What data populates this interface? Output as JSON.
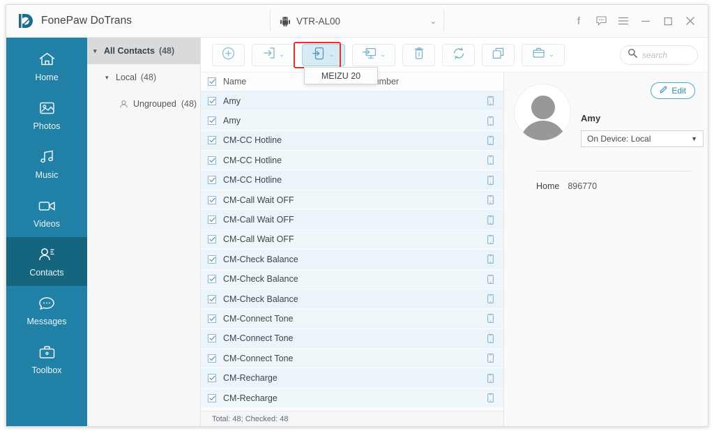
{
  "window": {
    "brand": "FonePaw DoTrans",
    "logo_icon": "dotrans-logo-icon",
    "device": {
      "icon": "android-robot-icon",
      "name": "VTR-AL00",
      "chevron": "⌄"
    },
    "controls": [
      {
        "name": "facebook-button",
        "glyph": "f"
      },
      {
        "name": "feedback-button",
        "glyph": "💬"
      },
      {
        "name": "menu-button",
        "glyph": "≡"
      },
      {
        "name": "minimize-button",
        "glyph": "–"
      },
      {
        "name": "maximize-button",
        "glyph": "□"
      },
      {
        "name": "close-button",
        "glyph": "✕"
      }
    ]
  },
  "sidebar": {
    "items": [
      {
        "label": "Home",
        "icon": "home-icon",
        "active": false
      },
      {
        "label": "Photos",
        "icon": "photos-icon",
        "active": false
      },
      {
        "label": "Music",
        "icon": "music-icon",
        "active": false
      },
      {
        "label": "Videos",
        "icon": "videos-icon",
        "active": false
      },
      {
        "label": "Contacts",
        "icon": "contacts-icon",
        "active": true
      },
      {
        "label": "Messages",
        "icon": "messages-icon",
        "active": false
      },
      {
        "label": "Toolbox",
        "icon": "toolbox-icon",
        "active": false
      }
    ],
    "active_bg": "#16657f",
    "bg": "#2180a5"
  },
  "tree": {
    "all_contacts": {
      "label": "All Contacts",
      "count": "(48)",
      "caret": "▾"
    },
    "local": {
      "label": "Local",
      "count": "(48)",
      "caret": "▾"
    },
    "ungrouped": {
      "label": "Ungrouped",
      "count": "(48)",
      "icon": "person-icon"
    }
  },
  "toolbar": {
    "buttons": [
      {
        "name": "add-contact-button",
        "icon": "plus-circle-icon",
        "chevron": false,
        "highlighted": false
      },
      {
        "name": "import-button",
        "icon": "import-arrow-icon",
        "chevron": true,
        "highlighted": false
      },
      {
        "name": "export-to-device-button",
        "icon": "export-phone-icon",
        "chevron": true,
        "highlighted": true
      },
      {
        "name": "export-to-computer-button",
        "icon": "export-monitor-icon",
        "chevron": true,
        "highlighted": false
      },
      {
        "name": "delete-button",
        "icon": "trash-icon",
        "chevron": false,
        "highlighted": false
      },
      {
        "name": "refresh-button",
        "icon": "refresh-icon",
        "chevron": false,
        "highlighted": false
      },
      {
        "name": "deduplicate-button",
        "icon": "copy-squares-icon",
        "chevron": false,
        "highlighted": false
      },
      {
        "name": "toolbox-button",
        "icon": "briefcase-icon",
        "chevron": true,
        "highlighted": false
      }
    ],
    "chevron_glyph": "⌄",
    "dropdown": {
      "option": "MEIZU 20"
    },
    "highlight_color": "#ef2b2b"
  },
  "search": {
    "placeholder": "search",
    "icon": "search-icon"
  },
  "list": {
    "columns": {
      "name": "Name",
      "phone": "Phone Number"
    },
    "header_checkbox_checked": true,
    "rows": [
      {
        "name": "Amy",
        "phone": "",
        "checked": true,
        "source_icon": "phone-icon"
      },
      {
        "name": "Amy",
        "phone": "",
        "checked": true,
        "source_icon": "phone-icon"
      },
      {
        "name": "CM-CC Hotline",
        "phone": "",
        "checked": true,
        "source_icon": "phone-icon"
      },
      {
        "name": "CM-CC Hotline",
        "phone": "",
        "checked": true,
        "source_icon": "phone-icon"
      },
      {
        "name": "CM-CC Hotline",
        "phone": "",
        "checked": true,
        "source_icon": "phone-icon"
      },
      {
        "name": "CM-Call Wait OFF",
        "phone": "",
        "checked": true,
        "source_icon": "phone-icon"
      },
      {
        "name": "CM-Call Wait OFF",
        "phone": "",
        "checked": true,
        "source_icon": "phone-icon"
      },
      {
        "name": "CM-Call Wait OFF",
        "phone": "",
        "checked": true,
        "source_icon": "phone-icon"
      },
      {
        "name": "CM-Check Balance",
        "phone": "",
        "checked": true,
        "source_icon": "phone-icon"
      },
      {
        "name": "CM-Check Balance",
        "phone": "",
        "checked": true,
        "source_icon": "phone-icon"
      },
      {
        "name": "CM-Check Balance",
        "phone": "",
        "checked": true,
        "source_icon": "phone-icon"
      },
      {
        "name": "CM-Connect Tone",
        "phone": "",
        "checked": true,
        "source_icon": "phone-icon"
      },
      {
        "name": "CM-Connect Tone",
        "phone": "",
        "checked": true,
        "source_icon": "phone-icon"
      },
      {
        "name": "CM-Connect Tone",
        "phone": "",
        "checked": true,
        "source_icon": "phone-icon"
      },
      {
        "name": "CM-Recharge",
        "phone": "",
        "checked": true,
        "source_icon": "phone-icon"
      },
      {
        "name": "CM-Recharge",
        "phone": "",
        "checked": true,
        "source_icon": "phone-icon"
      }
    ],
    "status": "Total: 48; Checked: 48"
  },
  "detail": {
    "avatar_icon": "default-avatar-icon",
    "edit_label": "Edit",
    "edit_icon": "pencil-icon",
    "contact_name": "Amy",
    "device_select": {
      "value": "On Device: Local",
      "arrow": "▼"
    },
    "fields": [
      {
        "label": "Home",
        "value": "896770"
      }
    ]
  }
}
